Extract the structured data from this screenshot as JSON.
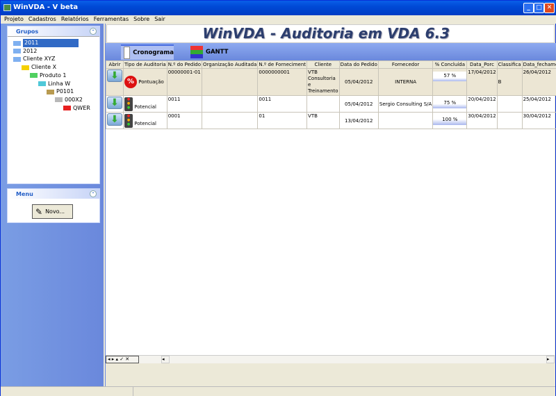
{
  "window": {
    "title": "WinVDA - V beta"
  },
  "menu": [
    "Projeto",
    "Cadastros",
    "Relatórios",
    "Ferramentas",
    "Sobre",
    "Sair"
  ],
  "groups": {
    "title": "Grupos",
    "tree": [
      {
        "label": "2011",
        "level": 0,
        "color": "#7fb0f0",
        "selected": true
      },
      {
        "label": "2012",
        "level": 0,
        "color": "#7fb0f0"
      },
      {
        "label": "Cliente XYZ",
        "level": 0,
        "color": "#7fb0f0"
      },
      {
        "label": "Cliente X",
        "level": 1,
        "color": "#f5d000"
      },
      {
        "label": "Produto 1",
        "level": 2,
        "color": "#50d060"
      },
      {
        "label": "Linha W",
        "level": 3,
        "color": "#50c8d8"
      },
      {
        "label": "P0101",
        "level": 4,
        "color": "#b89a50"
      },
      {
        "label": "000X2",
        "level": 5,
        "color": "#b8b8b8"
      },
      {
        "label": "QWER",
        "level": 6,
        "color": "#e82020"
      }
    ]
  },
  "side_menu": {
    "title": "Menu",
    "novo_label": "Novo..."
  },
  "header": {
    "title": "WinVDA - Auditoria em VDA 6.3"
  },
  "tabs": [
    {
      "label": "Cronograma",
      "active": true
    },
    {
      "label": "GANTT"
    }
  ],
  "table": {
    "columns": [
      "Abrir",
      "Tipo de Auditoria",
      "N.º do Pedido",
      "Organização Auditada",
      "N.º de Forneciment",
      "Cliente",
      "Data do Pedido",
      "Fornecedor",
      "% Concluída",
      "Data_Porc",
      "Classifica",
      "Data_fechamento"
    ],
    "rows": [
      {
        "tipo": "Pontuação",
        "tipo_icon": "percent-icon",
        "pedido": "00000001-01",
        "org": "",
        "fornecimento": "0000000001",
        "cliente": "VTB Consultoria e Treinamento",
        "data_pedido": "05/04/2012",
        "fornecedor": "INTERNA",
        "concluida": "57 %",
        "progress": 57,
        "data_porc": "17/04/2012",
        "classifica": "B",
        "data_fechamento": "26/04/2012"
      },
      {
        "tipo": "Potencial",
        "tipo_icon": "traffic-light-icon",
        "pedido": "0011",
        "org": "",
        "fornecimento": "0011",
        "cliente": "",
        "data_pedido": "05/04/2012",
        "fornecedor": "Sergio Consulting S/A",
        "concluida": "75 %",
        "progress": 75,
        "data_porc": "20/04/2012",
        "classifica": "",
        "data_fechamento": "25/04/2012"
      },
      {
        "tipo": "Potencial",
        "tipo_icon": "traffic-light-icon",
        "pedido": "0001",
        "org": "",
        "fornecimento": "01",
        "cliente": "VTB",
        "data_pedido": "13/04/2012",
        "fornecedor": "",
        "concluida": "100 %",
        "progress": 100,
        "data_porc": "30/04/2012",
        "classifica": "",
        "data_fechamento": "30/04/2012"
      }
    ]
  }
}
